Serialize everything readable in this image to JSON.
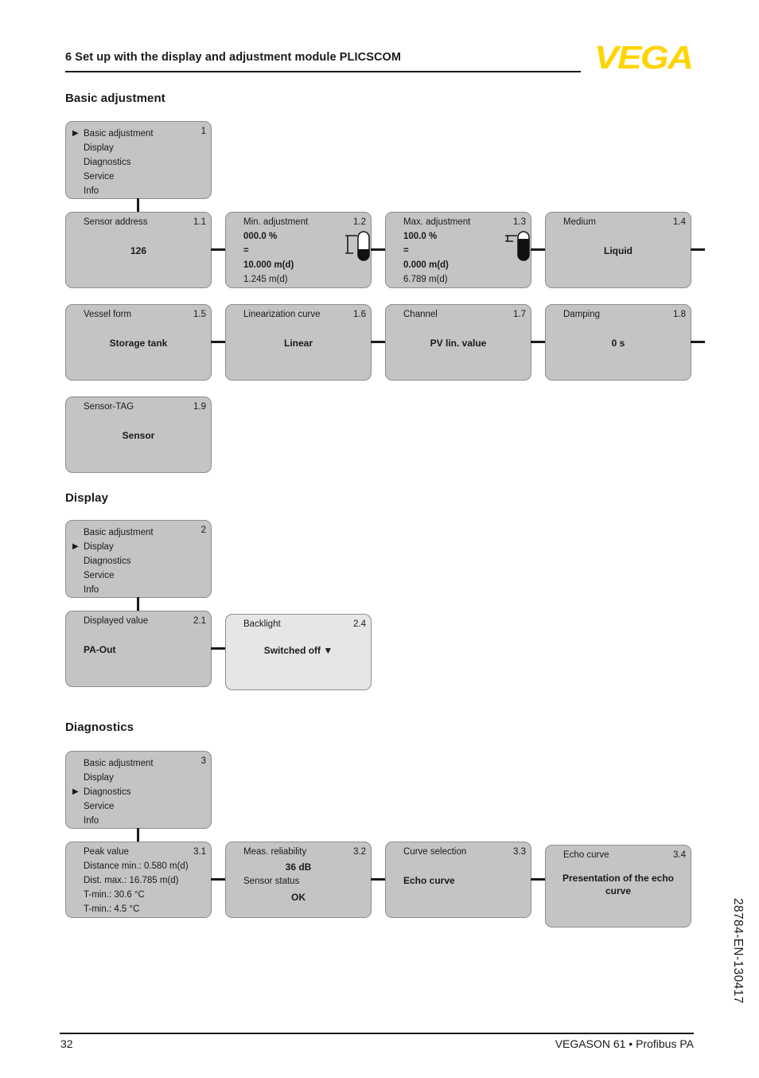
{
  "header": {
    "chapter_title": "6 Set up with the display and adjustment module PLICSCOM",
    "logo_text": "VEGA",
    "logo_color": "#ffd400"
  },
  "sections": [
    {
      "id": "basic",
      "heading": "Basic adjustment"
    },
    {
      "id": "display",
      "heading": "Display"
    },
    {
      "id": "diagnostics",
      "heading": "Diagnostics"
    }
  ],
  "menus": {
    "basic": {
      "number": "1",
      "items": [
        "Basic adjustment",
        "Display",
        "Diagnostics",
        "Service",
        "Info"
      ],
      "selected_index": 0,
      "caret": "▶"
    },
    "display": {
      "number": "2",
      "items": [
        "Basic adjustment",
        "Display",
        "Diagnostics",
        "Service",
        "Info"
      ],
      "selected_index": 1,
      "caret": "▶"
    },
    "diagnostics": {
      "number": "3",
      "items": [
        "Basic adjustment",
        "Display",
        "Diagnostics",
        "Service",
        "Info"
      ],
      "selected_index": 2,
      "caret": "▶"
    }
  },
  "basic_boxes": {
    "b11": {
      "title": "Sensor address",
      "number": "1.1",
      "value": "126"
    },
    "b12": {
      "title": "Min. adjustment",
      "number": "1.2",
      "percent": "000.0 %",
      "equals": "=",
      "distance": "10.000 m(d)",
      "measured": "1.245 m(d)",
      "icon": "tank-level-low-icon"
    },
    "b13": {
      "title": "Max. adjustment",
      "number": "1.3",
      "percent": "100.0 %",
      "equals": "=",
      "distance": "0.000 m(d)",
      "measured": "6.789 m(d)",
      "icon": "tank-level-high-icon"
    },
    "b14": {
      "title": "Medium",
      "number": "1.4",
      "value": "Liquid"
    },
    "b15": {
      "title": "Vessel form",
      "number": "1.5",
      "value": "Storage tank"
    },
    "b16": {
      "title": "Linearization curve",
      "number": "1.6",
      "value": "Linear"
    },
    "b17": {
      "title": "Channel",
      "number": "1.7",
      "value": "PV lin. value"
    },
    "b18": {
      "title": "Damping",
      "number": "1.8",
      "value": "0 s"
    },
    "b19": {
      "title": "Sensor-TAG",
      "number": "1.9",
      "value": "Sensor"
    }
  },
  "display_boxes": {
    "b21": {
      "title": "Displayed value",
      "number": "2.1",
      "value": "PA-Out"
    },
    "b24": {
      "title": "Backlight",
      "number": "2.4",
      "value": "Switched off ▼"
    }
  },
  "diagnostics_boxes": {
    "b31": {
      "title": "Peak value",
      "number": "3.1",
      "lines": [
        "Distance min.: 0.580 m(d)",
        "Dist. max.: 16.785 m(d)",
        "T-min.: 30.6 °C",
        "T-min.: 4.5 °C"
      ]
    },
    "b32": {
      "title": "Meas. reliability",
      "number": "3.2",
      "value": "36 dB",
      "status_label": "Sensor status",
      "status_value": "OK"
    },
    "b33": {
      "title": "Curve selection",
      "number": "3.3",
      "value": "Echo curve"
    },
    "b34": {
      "title": "Echo curve",
      "number": "3.4",
      "value": "Presentation of the echo curve"
    }
  },
  "side_code": "28784-EN-130417",
  "footer": {
    "page_number": "32",
    "product": "VEGASON 61 • Profibus PA"
  }
}
